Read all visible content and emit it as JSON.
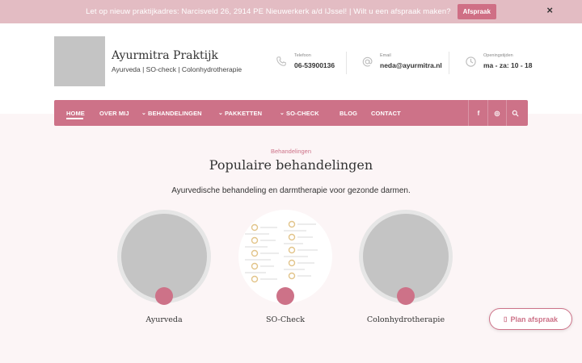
{
  "announcement": {
    "text": "Let op nieuw praktijkadres: Narcisveld 26, 2914 PE Nieuwerkerk a/d IJssel! | Wilt u een afspraak maken?",
    "button_label": "Afspraak",
    "close_glyph": "×"
  },
  "brand": {
    "title": "Ayurmitra Praktijk",
    "subtitle": "Ayurveda | SO-check | Colonhydrotherapie"
  },
  "contact": {
    "phone": {
      "label": "Telefoon",
      "value": "06-53900136",
      "icon": "phone-icon"
    },
    "email": {
      "label": "Email",
      "value": "neda@ayurmitra.nl",
      "icon": "at-icon"
    },
    "hours": {
      "label": "Openingstijden",
      "value": "ma - za: 10 - 18",
      "icon": "clock-icon"
    }
  },
  "nav": {
    "items": [
      {
        "label": "HOME",
        "active": true,
        "dropdown": false
      },
      {
        "label": "OVER MIJ",
        "active": false,
        "dropdown": false
      },
      {
        "label": "BEHANDELINGEN",
        "active": false,
        "dropdown": true
      },
      {
        "label": "PAKKETTEN",
        "active": false,
        "dropdown": true
      },
      {
        "label": "SO-CHECK",
        "active": false,
        "dropdown": true
      },
      {
        "label": "BLOG",
        "active": false,
        "dropdown": false
      },
      {
        "label": "CONTACT",
        "active": false,
        "dropdown": false
      }
    ],
    "icons": [
      "facebook-icon",
      "instagram-icon",
      "search-icon"
    ],
    "chevron_glyph": "⌄",
    "facebook_glyph": "f",
    "instagram_glyph": "◎",
    "search_glyph": "⌕"
  },
  "section": {
    "kicker": "Behandelingen",
    "title": "Populaire behandelingen",
    "subtitle": "Ayurvedische behandeling en darmtherapie voor gezonde darmen."
  },
  "cards": [
    {
      "label": "Ayurveda"
    },
    {
      "label": "SO-Check"
    },
    {
      "label": "Colonhydrotherapie"
    }
  ],
  "cta": {
    "label": "Plan afspraak",
    "icon": "calendar-icon",
    "glyph": "▯"
  },
  "colors": {
    "accent": "#cd7288",
    "topbar": "#e3bcc3",
    "background": "#fcf5f6"
  }
}
